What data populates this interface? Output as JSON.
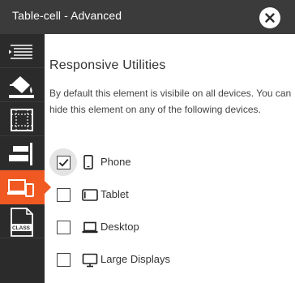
{
  "window": {
    "title": "Table-cell - Advanced"
  },
  "sidebar": {
    "items": [
      {
        "icon": "align-lines-icon",
        "active": false
      },
      {
        "icon": "paint-bucket-icon",
        "active": false
      },
      {
        "icon": "spacing-grid-icon",
        "active": false
      },
      {
        "icon": "align-right-bars-icon",
        "active": false
      },
      {
        "icon": "devices-icon",
        "active": true
      },
      {
        "icon": "class-file-icon",
        "active": false,
        "icon_text": "CLASS"
      }
    ]
  },
  "main": {
    "heading": "Responsive Utilities",
    "description": "By default this element is visibile on all devices. You can hide this element on any of the following devices.",
    "options": [
      {
        "label": "Phone",
        "icon": "phone-icon",
        "checked": true
      },
      {
        "label": "Tablet",
        "icon": "tablet-icon",
        "checked": false
      },
      {
        "label": "Desktop",
        "icon": "laptop-icon",
        "checked": false
      },
      {
        "label": "Large Displays",
        "icon": "monitor-icon",
        "checked": false
      }
    ]
  },
  "colors": {
    "titlebar": "#3b3b3b",
    "sidebar": "#2b2b2b",
    "accent": "#f05a22"
  }
}
